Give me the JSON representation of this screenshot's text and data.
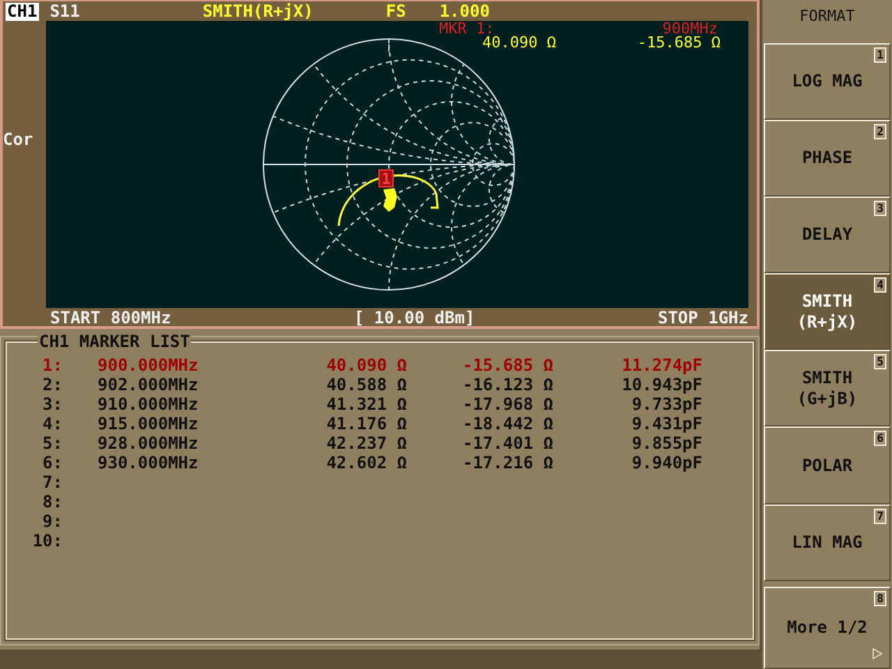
{
  "header": {
    "channel": "CH1",
    "parameter": "S11",
    "format": "SMITH(R+jX)",
    "scale_label": "FS",
    "scale_value": "1.000"
  },
  "marker_readout": {
    "label": "MKR 1:",
    "frequency": "900MHz",
    "resistance": "40.090 Ω",
    "reactance": "-15.685 Ω"
  },
  "side_label": "Cor",
  "chart_marker": "1",
  "footer": {
    "start": "START 800MHz",
    "power": "[ 10.00 dBm]",
    "stop": "STOP 1GHz"
  },
  "marker_list": {
    "title": "CH1 MARKER LIST",
    "rows": [
      {
        "number": "1:",
        "frequency": "900.000MHz",
        "resistance": "40.090 Ω",
        "reactance": "-15.685 Ω",
        "capacitance": "11.274pF",
        "selected": true
      },
      {
        "number": "2:",
        "frequency": "902.000MHz",
        "resistance": "40.588 Ω",
        "reactance": "-16.123 Ω",
        "capacitance": "10.943pF",
        "selected": false
      },
      {
        "number": "3:",
        "frequency": "910.000MHz",
        "resistance": "41.321 Ω",
        "reactance": "-17.968 Ω",
        "capacitance": "9.733pF",
        "selected": false
      },
      {
        "number": "4:",
        "frequency": "915.000MHz",
        "resistance": "41.176 Ω",
        "reactance": "-18.442 Ω",
        "capacitance": "9.431pF",
        "selected": false
      },
      {
        "number": "5:",
        "frequency": "928.000MHz",
        "resistance": "42.237 Ω",
        "reactance": "-17.401 Ω",
        "capacitance": "9.855pF",
        "selected": false
      },
      {
        "number": "6:",
        "frequency": "930.000MHz",
        "resistance": "42.602 Ω",
        "reactance": "-17.216 Ω",
        "capacitance": "9.940pF",
        "selected": false
      },
      {
        "number": "7:",
        "selected": false
      },
      {
        "number": "8:",
        "selected": false
      },
      {
        "number": "9:",
        "selected": false
      },
      {
        "number": "10:",
        "selected": false
      }
    ]
  },
  "menu": {
    "title": "FORMAT",
    "items": [
      {
        "label": "LOG MAG",
        "key": "1",
        "selected": false
      },
      {
        "label": "PHASE",
        "key": "2",
        "selected": false
      },
      {
        "label": "DELAY",
        "key": "3",
        "selected": false
      },
      {
        "label": "SMITH\n(R+jX)",
        "key": "4",
        "selected": true
      },
      {
        "label": "SMITH\n(G+jB)",
        "key": "5",
        "selected": false
      },
      {
        "label": "POLAR",
        "key": "6",
        "selected": false
      },
      {
        "label": "LIN MAG",
        "key": "7",
        "selected": false
      },
      {
        "label": "More 1/2",
        "key": "8",
        "selected": false,
        "has_submenu": true
      }
    ]
  }
}
